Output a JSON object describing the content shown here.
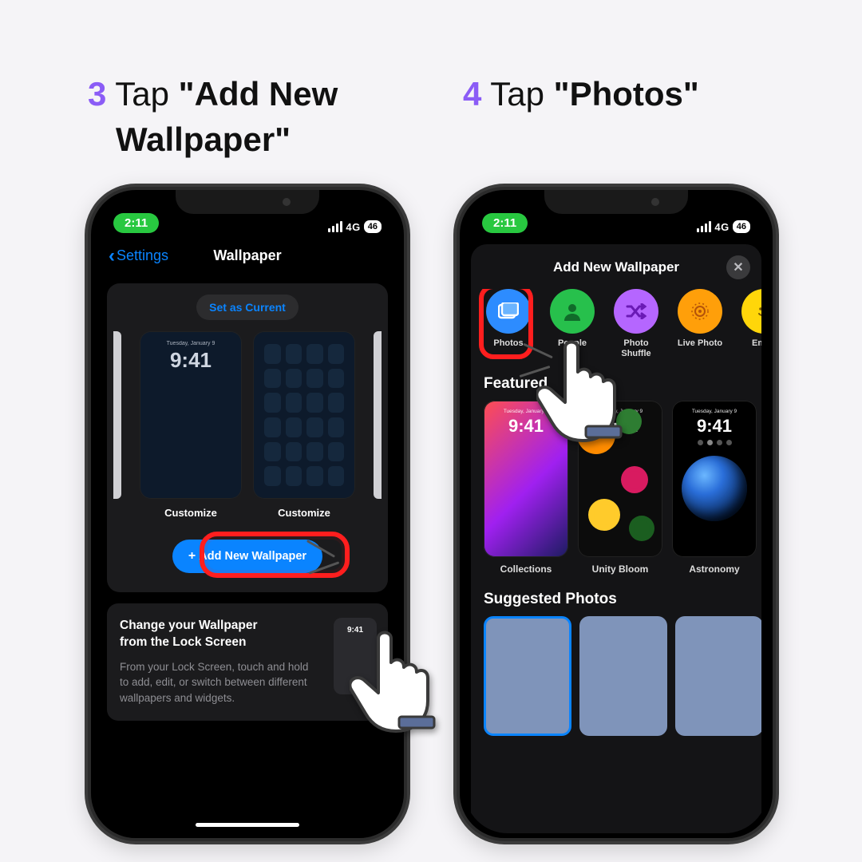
{
  "steps": {
    "left": {
      "num": "3",
      "verb": "Tap",
      "q1": "\"Add New",
      "q2": "Wallpaper\""
    },
    "right": {
      "num": "4",
      "verb": "Tap",
      "q1": "\"Photos\""
    }
  },
  "status": {
    "time": "2:11",
    "network": "4G",
    "battery": "46"
  },
  "screen_left": {
    "back_label": "Settings",
    "title": "Wallpaper",
    "set_current": "Set as Current",
    "preview_date": "Tuesday, January 9",
    "preview_time": "9:41",
    "customize": "Customize",
    "add_new": "Add New Wallpaper",
    "tip_title1": "Change your Wallpaper",
    "tip_title2": "from the Lock Screen",
    "tip_body": "From your Lock Screen, touch and hold to add, edit, or switch between different wallpapers and widgets.",
    "mini_time": "9:41"
  },
  "screen_right": {
    "sheet_title": "Add New Wallpaper",
    "categories": [
      {
        "key": "photos",
        "label": "Photos",
        "color": "blue",
        "icon": "image"
      },
      {
        "key": "people",
        "label": "People",
        "color": "green",
        "icon": "person"
      },
      {
        "key": "shuffle",
        "label": "Photo Shuffle",
        "color": "purple",
        "icon": "shuffle"
      },
      {
        "key": "livephoto",
        "label": "Live Photo",
        "color": "orange",
        "icon": "target"
      },
      {
        "key": "emoji",
        "label": "Emoji",
        "color": "yellow",
        "icon": "smile"
      }
    ],
    "featured_heading": "Featured",
    "featured": [
      {
        "key": "collections",
        "label": "Collections",
        "dl": "Tuesday, January 9",
        "tm": "9:41"
      },
      {
        "key": "unity",
        "label": "Unity Bloom",
        "dl": "Tuesday, January 9",
        "tm": "9:41"
      },
      {
        "key": "astronomy",
        "label": "Astronomy",
        "dl": "Tuesday, January 9",
        "tm": "9:41"
      }
    ],
    "suggested_heading": "Suggested Photos"
  }
}
